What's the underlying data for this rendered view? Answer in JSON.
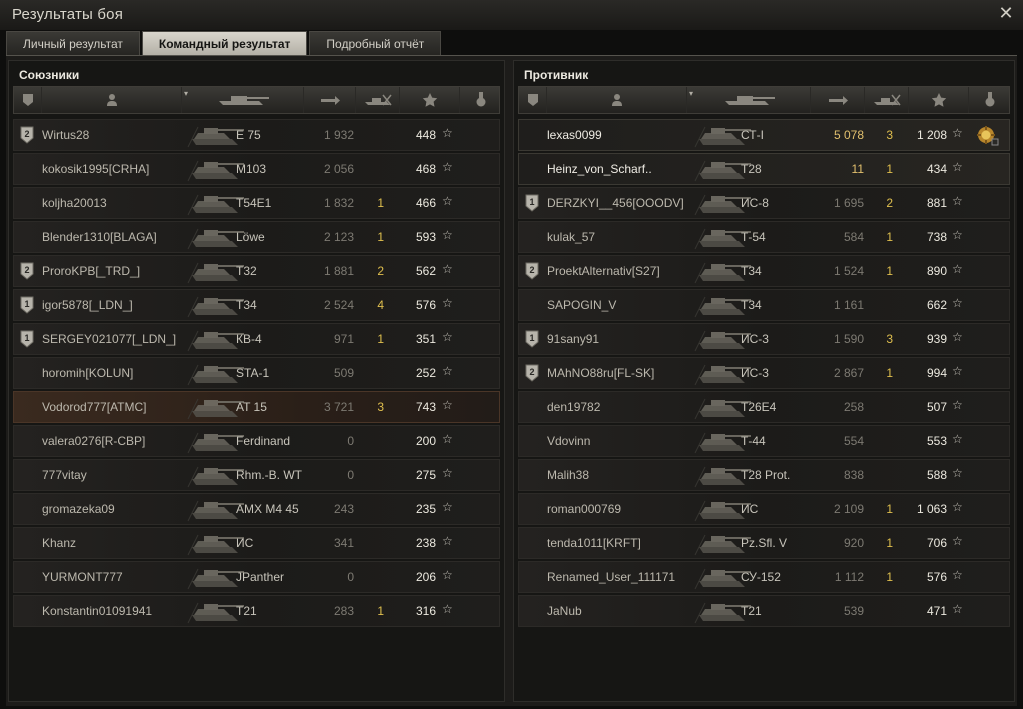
{
  "window": {
    "title": "Результаты боя",
    "close_label": "✕"
  },
  "tabs": [
    {
      "label": "Личный результат",
      "active": false
    },
    {
      "label": "Командный результат",
      "active": true
    },
    {
      "label": "Подробный отчёт",
      "active": false
    }
  ],
  "colors": {
    "kills": "#e0bf4e",
    "damage_top": "#e2c06e",
    "highlight_row": "#3a2a1f"
  },
  "allies": {
    "title": "Союзники",
    "players": [
      {
        "badge": "2",
        "name": "Wirtus28",
        "vehicle": "E 75",
        "damage": "1 932",
        "kills": "",
        "xp": "448"
      },
      {
        "badge": "",
        "name": "kokosik1995[CRHA]",
        "vehicle": "M103",
        "damage": "2 056",
        "kills": "",
        "xp": "468"
      },
      {
        "badge": "",
        "name": "koljha20013",
        "vehicle": "T54E1",
        "damage": "1 832",
        "kills": "1",
        "xp": "466"
      },
      {
        "badge": "",
        "name": "Blender1310[BLAGA]",
        "vehicle": "Löwe",
        "damage": "2 123",
        "kills": "1",
        "xp": "593"
      },
      {
        "badge": "2",
        "name": "ProroKPB[_TRD_]",
        "vehicle": "T32",
        "damage": "1 881",
        "kills": "2",
        "xp": "562"
      },
      {
        "badge": "1",
        "name": "igor5878[_LDN_]",
        "vehicle": "T34",
        "damage": "2 524",
        "kills": "4",
        "xp": "576"
      },
      {
        "badge": "1",
        "name": "SERGEY021077[_LDN_]",
        "vehicle": "КВ-4",
        "damage": "971",
        "kills": "1",
        "xp": "351"
      },
      {
        "badge": "",
        "name": "horomih[KOLUN]",
        "vehicle": "STA-1",
        "damage": "509",
        "kills": "",
        "xp": "252"
      },
      {
        "badge": "",
        "name": "Vodorod777[ATMC]",
        "vehicle": "AT 15",
        "damage": "3 721",
        "kills": "3",
        "xp": "743",
        "highlight": true
      },
      {
        "badge": "",
        "name": "valera0276[R-CBP]",
        "vehicle": "Ferdinand",
        "damage": "0",
        "kills": "",
        "xp": "200"
      },
      {
        "badge": "",
        "name": "777vitay",
        "vehicle": "Rhm.-B. WT",
        "damage": "0",
        "kills": "",
        "xp": "275"
      },
      {
        "badge": "",
        "name": "gromazeka09",
        "vehicle": "AMX M4 45",
        "damage": "243",
        "kills": "",
        "xp": "235"
      },
      {
        "badge": "",
        "name": "Khanz",
        "vehicle": "ИС",
        "damage": "341",
        "kills": "",
        "xp": "238"
      },
      {
        "badge": "",
        "name": "YURMONT777",
        "vehicle": "JPanther",
        "damage": "0",
        "kills": "",
        "xp": "206"
      },
      {
        "badge": "",
        "name": "Konstantin01091941",
        "vehicle": "T21",
        "damage": "283",
        "kills": "1",
        "xp": "316"
      }
    ]
  },
  "enemies": {
    "title": "Противник",
    "players": [
      {
        "badge": "",
        "name": "lexas0099",
        "vehicle": "СТ-I",
        "damage": "5 078",
        "kills": "3",
        "xp": "1 208",
        "top": true,
        "damage_hi": true,
        "medal": "medal-icon"
      },
      {
        "badge": "",
        "name": "Heinz_von_Scharf..",
        "vehicle": "T28",
        "damage": "11",
        "kills": "1",
        "xp": "434",
        "top": true,
        "damage_hi": true
      },
      {
        "badge": "1",
        "name": "DERZKYI__456[OOODV]",
        "vehicle": "ИС-8",
        "damage": "1 695",
        "kills": "2",
        "xp": "881"
      },
      {
        "badge": "",
        "name": "kulak_57",
        "vehicle": "Т-54",
        "damage": "584",
        "kills": "1",
        "xp": "738"
      },
      {
        "badge": "2",
        "name": "ProektAlternativ[S27]",
        "vehicle": "T34",
        "damage": "1 524",
        "kills": "1",
        "xp": "890"
      },
      {
        "badge": "",
        "name": "SAPOGIN_V",
        "vehicle": "T34",
        "damage": "1 161",
        "kills": "",
        "xp": "662"
      },
      {
        "badge": "1",
        "name": "91sany91",
        "vehicle": "ИС-3",
        "damage": "1 590",
        "kills": "3",
        "xp": "939"
      },
      {
        "badge": "2",
        "name": "MAhNO88ru[FL-SK]",
        "vehicle": "ИС-3",
        "damage": "2 867",
        "kills": "1",
        "xp": "994"
      },
      {
        "badge": "",
        "name": "den19782",
        "vehicle": "T26E4",
        "damage": "258",
        "kills": "",
        "xp": "507"
      },
      {
        "badge": "",
        "name": "Vdovinn",
        "vehicle": "Т-44",
        "damage": "554",
        "kills": "",
        "xp": "553"
      },
      {
        "badge": "",
        "name": "Malih38",
        "vehicle": "T28 Prot.",
        "damage": "838",
        "kills": "",
        "xp": "588"
      },
      {
        "badge": "",
        "name": "roman000769",
        "vehicle": "ИС",
        "damage": "2 109",
        "kills": "1",
        "xp": "1 063"
      },
      {
        "badge": "",
        "name": "tenda1011[KRFT]",
        "vehicle": "Pz.Sfl. V",
        "damage": "920",
        "kills": "1",
        "xp": "706"
      },
      {
        "badge": "",
        "name": "Renamed_User_111171",
        "vehicle": "СУ-152",
        "damage": "1 112",
        "kills": "1",
        "xp": "576"
      },
      {
        "badge": "",
        "name": "JaNub",
        "vehicle": "T21",
        "damage": "539",
        "kills": "",
        "xp": "471"
      }
    ]
  }
}
